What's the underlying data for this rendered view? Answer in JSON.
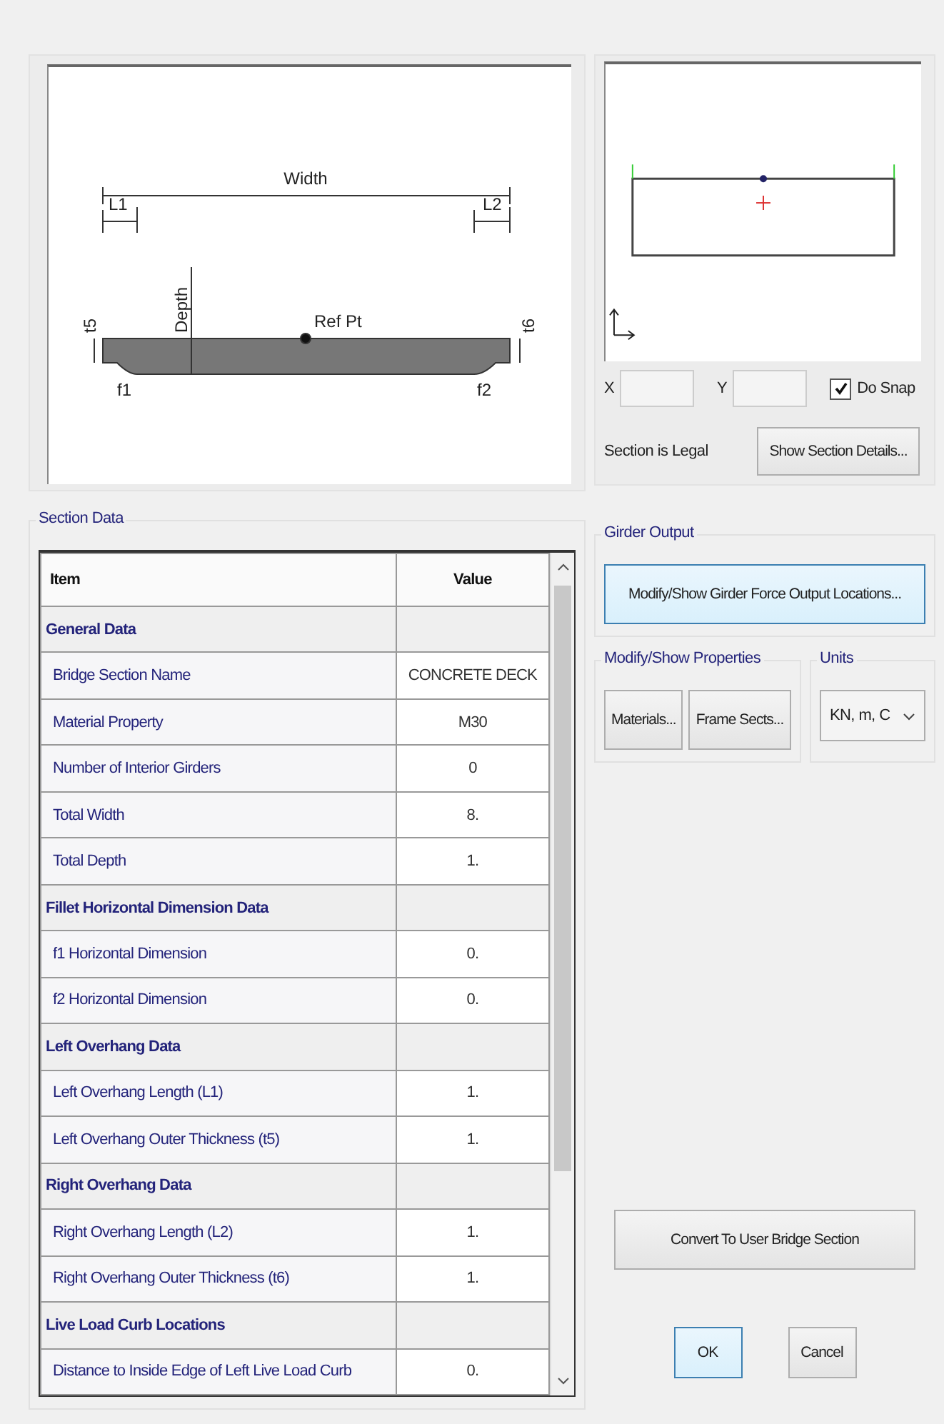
{
  "diagram": {
    "width_label": "Width",
    "l1_label": "L1",
    "l2_label": "L2",
    "depth_label": "Depth",
    "t5_label": "t5",
    "t6_label": "t6",
    "ref_label": "Ref Pt",
    "f1_label": "f1",
    "f2_label": "f2"
  },
  "preview": {
    "x_label": "X",
    "y_label": "Y",
    "snap": {
      "label": "Do Snap",
      "checked": true
    },
    "status": "Section is Legal",
    "details_button": "Show Section Details..."
  },
  "section_data": {
    "title": "Section Data",
    "columns": [
      "Item",
      "Value"
    ],
    "rows": [
      {
        "kind": "section",
        "item": "General Data"
      },
      {
        "kind": "item",
        "item": "Bridge Section Name",
        "value": "CONCRETE DECK"
      },
      {
        "kind": "item",
        "item": "Material Property",
        "value": "M30"
      },
      {
        "kind": "item",
        "item": "Number of Interior Girders",
        "value": "0"
      },
      {
        "kind": "item",
        "item": "Total Width",
        "value": "8."
      },
      {
        "kind": "item",
        "item": "Total Depth",
        "value": "1."
      },
      {
        "kind": "section",
        "item": "Fillet Horizontal Dimension Data"
      },
      {
        "kind": "item",
        "item": "f1 Horizontal Dimension",
        "value": "0."
      },
      {
        "kind": "item",
        "item": "f2 Horizontal Dimension",
        "value": "0."
      },
      {
        "kind": "section",
        "item": "Left Overhang Data"
      },
      {
        "kind": "item",
        "item": "Left Overhang Length (L1)",
        "value": "1."
      },
      {
        "kind": "item",
        "item": "Left Overhang Outer Thickness (t5)",
        "value": "1."
      },
      {
        "kind": "section",
        "item": "Right Overhang Data"
      },
      {
        "kind": "item",
        "item": "Right Overhang Length (L2)",
        "value": "1."
      },
      {
        "kind": "item",
        "item": "Right Overhang Outer Thickness (t6)",
        "value": "1."
      },
      {
        "kind": "section",
        "item": "Live Load Curb Locations"
      },
      {
        "kind": "item",
        "item": "Distance to Inside Edge of Left Live Load Curb",
        "value": "0."
      }
    ]
  },
  "girder_output": {
    "title": "Girder Output",
    "button": "Modify/Show Girder Force Output Locations..."
  },
  "properties": {
    "title": "Modify/Show Properties",
    "buttons": [
      "Materials...",
      "Frame Sects..."
    ]
  },
  "units": {
    "title": "Units",
    "value": "KN, m, C"
  },
  "convert_button": "Convert To User Bridge Section",
  "buttons": [
    {
      "label": "OK",
      "default": true
    },
    {
      "label": "Cancel",
      "default": false
    }
  ]
}
